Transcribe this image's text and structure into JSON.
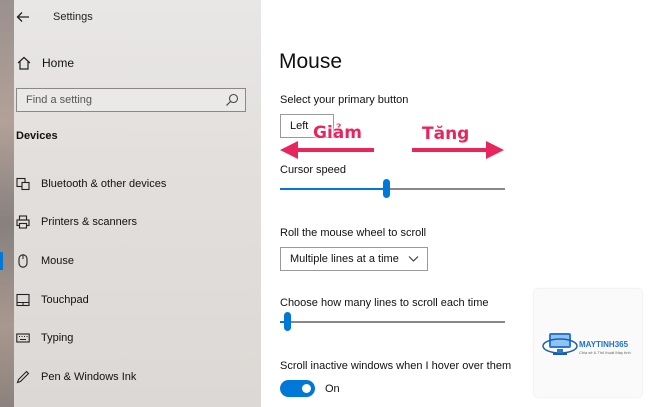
{
  "window": {
    "app_title": "Settings"
  },
  "sidebar": {
    "home_label": "Home",
    "search_placeholder": "Find a setting",
    "section_title": "Devices",
    "items": [
      {
        "label": "Bluetooth & other devices",
        "icon": "bluetooth-devices-icon"
      },
      {
        "label": "Printers & scanners",
        "icon": "printer-icon"
      },
      {
        "label": "Mouse",
        "icon": "mouse-icon",
        "active": true
      },
      {
        "label": "Touchpad",
        "icon": "touchpad-icon"
      },
      {
        "label": "Typing",
        "icon": "keyboard-icon"
      },
      {
        "label": "Pen & Windows Ink",
        "icon": "pen-icon"
      }
    ]
  },
  "main": {
    "title": "Mouse",
    "primary_button": {
      "label": "Select your primary button",
      "value": "Left"
    },
    "cursor_speed": {
      "label": "Cursor speed",
      "level": 0.47
    },
    "scroll_mode": {
      "label": "Roll the mouse wheel to scroll",
      "value": "Multiple lines at a time"
    },
    "lines_to_scroll": {
      "label": "Choose how many lines to scroll each time",
      "level": 0.03
    },
    "scroll_inactive": {
      "label": "Scroll inactive windows when I hover over them",
      "state": "On"
    }
  },
  "annotations": {
    "decrease": "Giảm",
    "increase": "Tăng",
    "color": "#e8255d"
  },
  "watermark": {
    "brand": "MAYTINH365",
    "tagline": "Chia sẻ & Thủ thuật Máy tính"
  },
  "colors": {
    "accent": "#0078d7"
  }
}
